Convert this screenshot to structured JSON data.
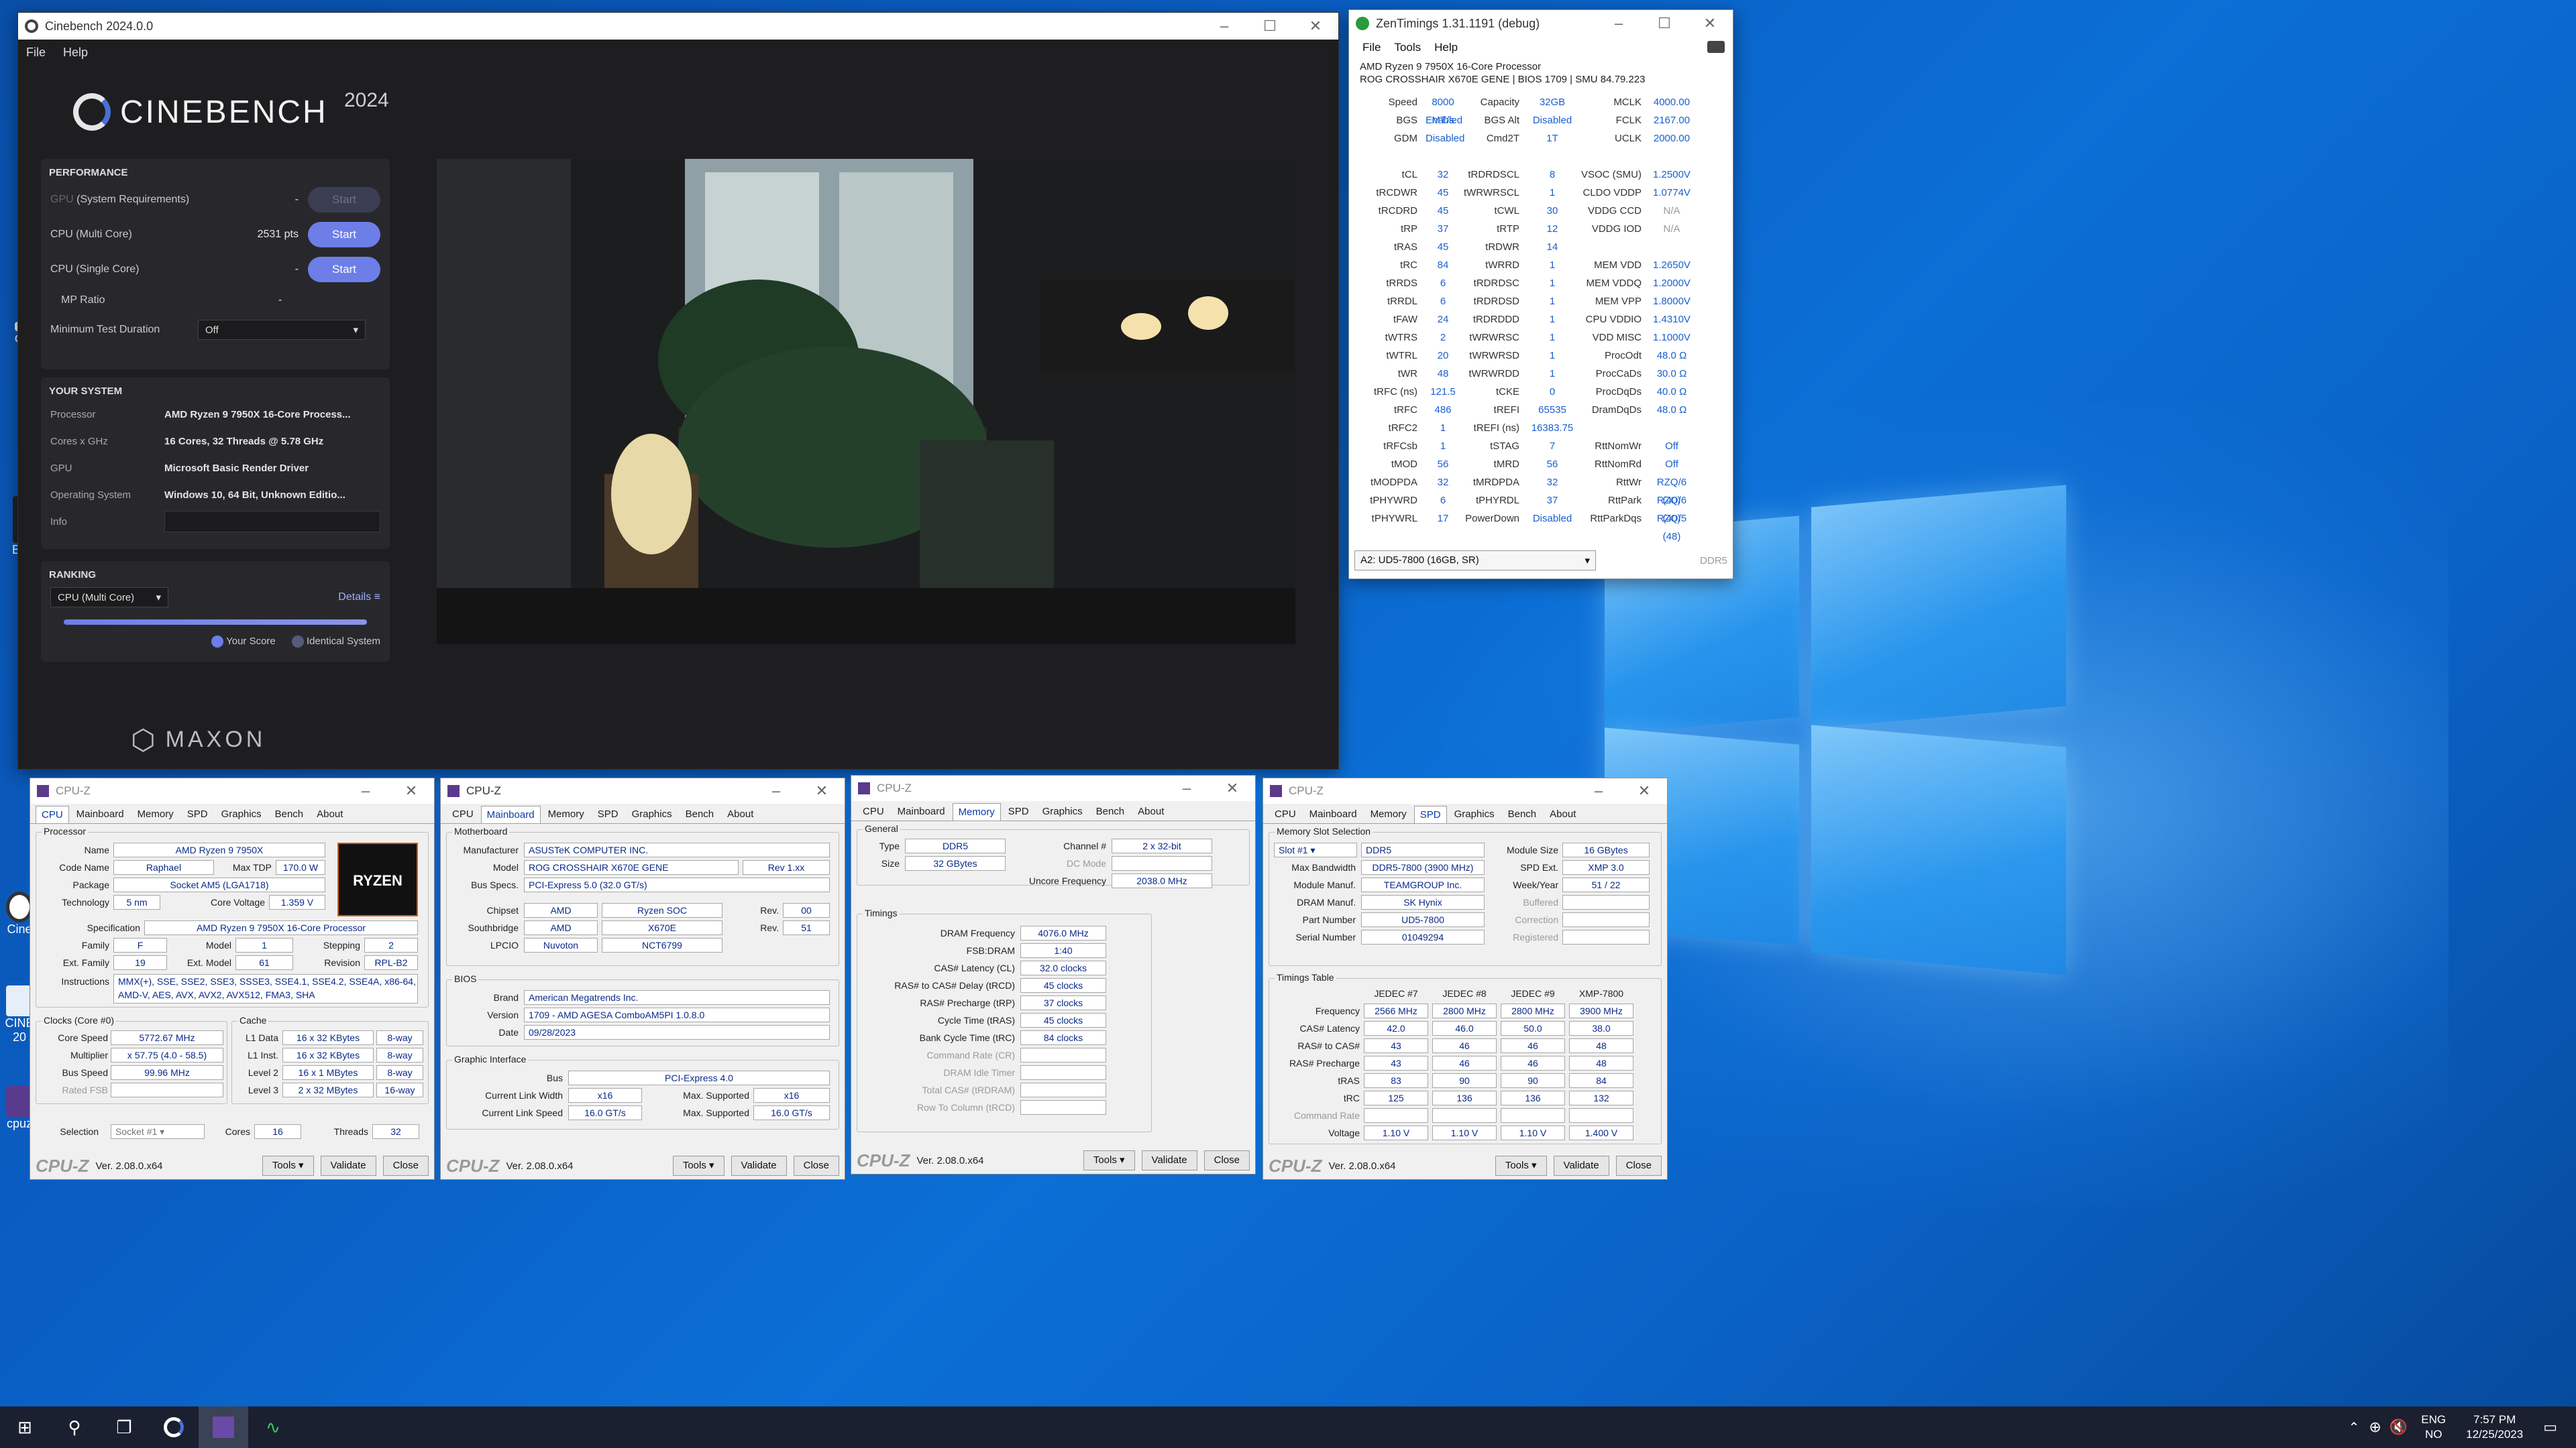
{
  "desktop": {
    "icons": [
      "di",
      "Be",
      "Cine",
      "CINE 20",
      "cpuz"
    ]
  },
  "cinebench": {
    "title": "Cinebench 2024.0.0",
    "menu": [
      "File",
      "Help"
    ],
    "logo": "CINEBENCH",
    "year": "2024",
    "performance": {
      "header": "PERFORMANCE",
      "gpu_label": "GPU",
      "gpu_sub": "(System Requirements)",
      "gpu_value": "-",
      "multi_label": "CPU (Multi Core)",
      "multi_value": "2531 pts",
      "single_label": "CPU (Single Core)",
      "single_value": "-",
      "mp_label": "MP Ratio",
      "mp_value": "-",
      "duration_label": "Minimum Test Duration",
      "duration_value": "Off",
      "start": "Start"
    },
    "system": {
      "header": "YOUR SYSTEM",
      "rows": [
        {
          "k": "Processor",
          "v": "AMD Ryzen 9 7950X 16-Core Process..."
        },
        {
          "k": "Cores x GHz",
          "v": "16 Cores, 32 Threads @ 5.78 GHz"
        },
        {
          "k": "GPU",
          "v": "Microsoft Basic Render Driver"
        },
        {
          "k": "Operating System",
          "v": "Windows 10, 64 Bit, Unknown Editio..."
        },
        {
          "k": "Info",
          "v": ""
        }
      ]
    },
    "ranking": {
      "header": "RANKING",
      "select": "CPU (Multi Core)",
      "details": "Details",
      "your_score": "Your Score",
      "identical": "Identical System"
    },
    "maxon": "MAXON"
  },
  "zentimings": {
    "title": "ZenTimings 1.31.1191 (debug)",
    "menu": [
      "File",
      "Tools",
      "Help"
    ],
    "cpu": "AMD Ryzen 9 7950X 16-Core Processor",
    "board": "ROG CROSSHAIR X670E GENE | BIOS 1709 | SMU 84.79.223",
    "rows": [
      [
        "Speed",
        "8000 MT/s",
        "Capacity",
        "32GB",
        "MCLK",
        "4000.00"
      ],
      [
        "BGS",
        "Enabled",
        "BGS Alt",
        "Disabled",
        "FCLK",
        "2167.00"
      ],
      [
        "GDM",
        "Disabled",
        "Cmd2T",
        "1T",
        "UCLK",
        "2000.00"
      ],
      [
        "",
        "",
        "",
        "",
        "",
        ""
      ],
      [
        "tCL",
        "32",
        "tRDRDSCL",
        "8",
        "VSOC (SMU)",
        "1.2500V"
      ],
      [
        "tRCDWR",
        "45",
        "tWRWRSCL",
        "1",
        "CLDO VDDP",
        "1.0774V"
      ],
      [
        "tRCDRD",
        "45",
        "tCWL",
        "30",
        "VDDG CCD",
        "N/A"
      ],
      [
        "tRP",
        "37",
        "tRTP",
        "12",
        "VDDG IOD",
        "N/A"
      ],
      [
        "tRAS",
        "45",
        "tRDWR",
        "14",
        "",
        ""
      ],
      [
        "tRC",
        "84",
        "tWRRD",
        "1",
        "MEM VDD",
        "1.2650V"
      ],
      [
        "tRRDS",
        "6",
        "tRDRDSC",
        "1",
        "MEM VDDQ",
        "1.2000V"
      ],
      [
        "tRRDL",
        "6",
        "tRDRDSD",
        "1",
        "MEM VPP",
        "1.8000V"
      ],
      [
        "tFAW",
        "24",
        "tRDRDDD",
        "1",
        "CPU VDDIO",
        "1.4310V"
      ],
      [
        "tWTRS",
        "2",
        "tWRWRSC",
        "1",
        "VDD MISC",
        "1.1000V"
      ],
      [
        "tWTRL",
        "20",
        "tWRWRSD",
        "1",
        "ProcOdt",
        "48.0 Ω"
      ],
      [
        "tWR",
        "48",
        "tWRWRDD",
        "1",
        "ProcCaDs",
        "30.0 Ω"
      ],
      [
        "tRFC (ns)",
        "121.5",
        "tCKE",
        "0",
        "ProcDqDs",
        "40.0 Ω"
      ],
      [
        "tRFC",
        "486",
        "tREFI",
        "65535",
        "DramDqDs",
        "48.0 Ω"
      ],
      [
        "tRFC2",
        "1",
        "tREFI (ns)",
        "16383.75",
        "",
        ""
      ],
      [
        "tRFCsb",
        "1",
        "tSTAG",
        "7",
        "RttNomWr",
        "Off"
      ],
      [
        "tMOD",
        "56",
        "tMRD",
        "56",
        "RttNomRd",
        "Off"
      ],
      [
        "tMODPDA",
        "32",
        "tMRDPDA",
        "32",
        "RttWr",
        "RZQ/6 (40)"
      ],
      [
        "tPHYWRD",
        "6",
        "tPHYRDL",
        "37",
        "RttPark",
        "RZQ/6 (40)"
      ],
      [
        "tPHYWRL",
        "17",
        "PowerDown",
        "Disabled",
        "RttParkDqs",
        "RZQ/5 (48)"
      ]
    ],
    "slot": "A2: UD5-7800 (16GB, SR)",
    "ddr": "DDR5"
  },
  "cpuz_common": {
    "title": "CPU-Z",
    "logo": "CPU-Z",
    "version": "Ver. 2.08.0.x64",
    "tools": "Tools",
    "validate": "Validate",
    "close": "Close",
    "tabs": [
      "CPU",
      "Mainboard",
      "Memory",
      "SPD",
      "Graphics",
      "Bench",
      "About"
    ]
  },
  "cpuz_cpu": {
    "processor": "Processor",
    "name_k": "Name",
    "name": "AMD Ryzen 9 7950X",
    "code_k": "Code Name",
    "code": "Raphael",
    "tdp_k": "Max TDP",
    "tdp": "170.0 W",
    "pkg_k": "Package",
    "pkg": "Socket AM5 (LGA1718)",
    "tech_k": "Technology",
    "tech": "5 nm",
    "volt_k": "Core Voltage",
    "volt": "1.359 V",
    "spec_k": "Specification",
    "spec": "AMD Ryzen 9 7950X 16-Core Processor",
    "fam_k": "Family",
    "fam": "F",
    "model_k": "Model",
    "model": "1",
    "step_k": "Stepping",
    "step": "2",
    "efam_k": "Ext. Family",
    "efam": "19",
    "emod_k": "Ext. Model",
    "emod": "61",
    "rev_k": "Revision",
    "rev": "RPL-B2",
    "inst_k": "Instructions",
    "inst": "MMX(+), SSE, SSE2, SSE3, SSSE3, SSE4.1, SSE4.2, SSE4A, x86-64, AMD-V, AES, AVX, AVX2, AVX512, FMA3, SHA",
    "clocks": "Clocks (Core #0)",
    "cspeed_k": "Core Speed",
    "cspeed": "5772.67 MHz",
    "mult_k": "Multiplier",
    "mult": "x 57.75 (4.0 - 58.5)",
    "bus_k": "Bus Speed",
    "bus": "99.96 MHz",
    "rfsb_k": "Rated FSB",
    "rfsb": "",
    "cache": "Cache",
    "l1d_k": "L1 Data",
    "l1d": "16 x 32 KBytes",
    "l1d_w": "8-way",
    "l1i_k": "L1 Inst.",
    "l1i": "16 x 32 KBytes",
    "l1i_w": "8-way",
    "l2_k": "Level 2",
    "l2": "16 x 1 MBytes",
    "l2_w": "8-way",
    "l3_k": "Level 3",
    "l3": "2 x 32 MBytes",
    "l3_w": "16-way",
    "sel_k": "Selection",
    "sel": "Socket #1",
    "cores_k": "Cores",
    "cores": "16",
    "threads_k": "Threads",
    "threads": "32",
    "badge": "RYZEN"
  },
  "cpuz_mb": {
    "mb": "Motherboard",
    "manu_k": "Manufacturer",
    "manu": "ASUSTeK COMPUTER INC.",
    "model_k": "Model",
    "model": "ROG CROSSHAIR X670E GENE",
    "model_rev": "Rev 1.xx",
    "bus_k": "Bus Specs.",
    "bus": "PCI-Express 5.0 (32.0 GT/s)",
    "chip_k": "Chipset",
    "chip_a": "AMD",
    "chip_b": "Ryzen SOC",
    "rev_k": "Rev.",
    "chip_rev": "00",
    "sb_k": "Southbridge",
    "sb_a": "AMD",
    "sb_b": "X670E",
    "sb_rev": "51",
    "lpc_k": "LPCIO",
    "lpc_a": "Nuvoton",
    "lpc_b": "NCT6799",
    "bios": "BIOS",
    "brand_k": "Brand",
    "brand": "American Megatrends Inc.",
    "ver_k": "Version",
    "ver": "1709 - AMD AGESA ComboAM5PI 1.0.8.0",
    "date_k": "Date",
    "date": "09/28/2023",
    "gi": "Graphic Interface",
    "gbus_k": "Bus",
    "gbus": "PCI-Express 4.0",
    "clw_k": "Current Link Width",
    "clw": "x16",
    "msw_k": "Max. Supported",
    "msw": "x16",
    "cls_k": "Current Link Speed",
    "cls": "16.0 GT/s",
    "mss_k": "Max. Supported",
    "mss": "16.0 GT/s"
  },
  "cpuz_mem": {
    "general": "General",
    "type_k": "Type",
    "type": "DDR5",
    "chan_k": "Channel #",
    "chan": "2 x 32-bit",
    "size_k": "Size",
    "size": "32 GBytes",
    "dc_k": "DC Mode",
    "unc_k": "Uncore Frequency",
    "unc": "2038.0 MHz",
    "timings": "Timings",
    "rows": [
      [
        "DRAM Frequency",
        "4076.0 MHz"
      ],
      [
        "FSB:DRAM",
        "1:40"
      ],
      [
        "CAS# Latency (CL)",
        "32.0 clocks"
      ],
      [
        "RAS# to CAS# Delay (tRCD)",
        "45 clocks"
      ],
      [
        "RAS# Precharge (tRP)",
        "37 clocks"
      ],
      [
        "Cycle Time (tRAS)",
        "45 clocks"
      ],
      [
        "Bank Cycle Time (tRC)",
        "84 clocks"
      ],
      [
        "Command Rate (CR)",
        ""
      ],
      [
        "DRAM Idle Timer",
        ""
      ],
      [
        "Total CAS# (tRDRAM)",
        ""
      ],
      [
        "Row To Column (tRCD)",
        ""
      ]
    ]
  },
  "cpuz_spd": {
    "mss": "Memory Slot Selection",
    "slot": "Slot #1",
    "type": "DDR5",
    "msize_k": "Module Size",
    "msize": "16 GBytes",
    "mbw_k": "Max Bandwidth",
    "mbw": "DDR5-7800 (3900 MHz)",
    "spdx_k": "SPD Ext.",
    "spdx": "XMP 3.0",
    "mman_k": "Module Manuf.",
    "mman": "TEAMGROUP Inc.",
    "wy_k": "Week/Year",
    "wy": "51 / 22",
    "dman_k": "DRAM Manuf.",
    "dman": "SK Hynix",
    "buf_k": "Buffered",
    "pn_k": "Part Number",
    "pn": "UD5-7800",
    "corr_k": "Correction",
    "sn_k": "Serial Number",
    "sn": "01049294",
    "reg_k": "Registered",
    "tt": "Timings Table",
    "cols": [
      "JEDEC #7",
      "JEDEC #8",
      "JEDEC #9",
      "XMP-7800"
    ],
    "rows": [
      [
        "Frequency",
        "2566 MHz",
        "2800 MHz",
        "2800 MHz",
        "3900 MHz"
      ],
      [
        "CAS# Latency",
        "42.0",
        "46.0",
        "50.0",
        "38.0"
      ],
      [
        "RAS# to CAS#",
        "43",
        "46",
        "46",
        "48"
      ],
      [
        "RAS# Precharge",
        "43",
        "46",
        "46",
        "48"
      ],
      [
        "tRAS",
        "83",
        "90",
        "90",
        "84"
      ],
      [
        "tRC",
        "125",
        "136",
        "136",
        "132"
      ],
      [
        "Command Rate",
        "",
        "",
        "",
        ""
      ],
      [
        "Voltage",
        "1.10 V",
        "1.10 V",
        "1.10 V",
        "1.400 V"
      ]
    ]
  },
  "taskbar": {
    "lang1": "ENG",
    "lang2": "NO",
    "time": "7:57 PM",
    "date": "12/25/2023"
  }
}
